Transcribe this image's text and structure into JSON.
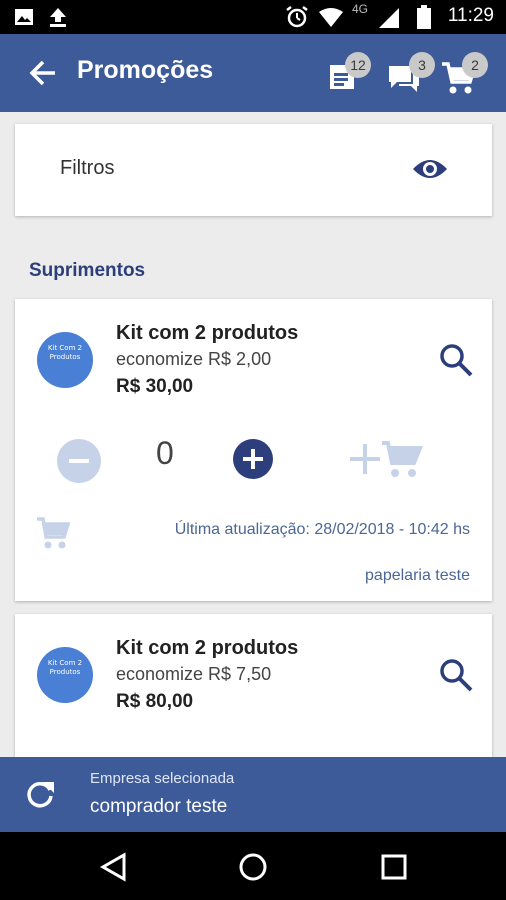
{
  "status_bar": {
    "network": "4G",
    "time": "11:29"
  },
  "header": {
    "title": "Promoções",
    "badges": {
      "orders": "12",
      "messages": "3",
      "cart": "2"
    }
  },
  "filters": {
    "label": "Filtros"
  },
  "section": {
    "title": "Suprimentos"
  },
  "products": [
    {
      "thumb_text": "Kit Com 2 Produtos",
      "name": "Kit com 2 produtos",
      "savings": "economize R$ 2,00",
      "price": "R$ 30,00",
      "quantity": "0",
      "updated": "Última atualização: 28/02/2018 - 10:42 hs",
      "seller": "papelaria teste"
    },
    {
      "thumb_text": "Kit Com 2 Produtos",
      "name": "Kit com 2 produtos",
      "savings": "economize R$ 7,50",
      "price": "R$ 80,00"
    }
  ],
  "company_bar": {
    "label": "Empresa selecionada",
    "value": "comprador teste"
  },
  "colors": {
    "primary": "#3d5a99",
    "accent_dark": "#2c3f7c",
    "thumb": "#4a7fd6",
    "disabled": "#c5d2e8"
  }
}
